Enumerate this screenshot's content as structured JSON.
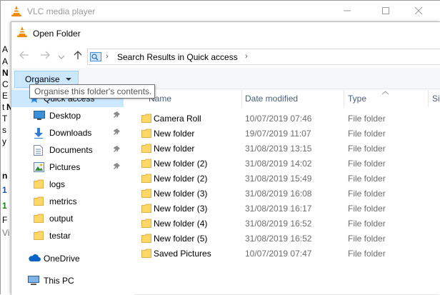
{
  "app": {
    "title": "VLC media player",
    "side_letters": [
      "A",
      "A",
      "N",
      "C",
      "E",
      "t",
      "N",
      "T",
      "s",
      "y",
      "n",
      "1",
      "1",
      "F",
      "Vi"
    ]
  },
  "dialog": {
    "title": "Open Folder",
    "address": {
      "location": "Search Results in Quick access"
    },
    "command_bar": {
      "organise_label": "Organise",
      "organise_tooltip": "Organise this folder's contents."
    },
    "nav_pane": {
      "items": [
        {
          "label": "Quick access",
          "icon": "star-icon",
          "selected": true,
          "pinned": false
        },
        {
          "label": "Desktop",
          "icon": "desktop-icon",
          "selected": false,
          "pinned": true
        },
        {
          "label": "Downloads",
          "icon": "download-arrow-icon",
          "selected": false,
          "pinned": true
        },
        {
          "label": "Documents",
          "icon": "documents-icon",
          "selected": false,
          "pinned": true
        },
        {
          "label": "Pictures",
          "icon": "pictures-icon",
          "selected": false,
          "pinned": true
        },
        {
          "label": "logs",
          "icon": "folder-icon",
          "selected": false,
          "pinned": false
        },
        {
          "label": "metrics",
          "icon": "folder-icon",
          "selected": false,
          "pinned": false
        },
        {
          "label": "output",
          "icon": "folder-icon",
          "selected": false,
          "pinned": false
        },
        {
          "label": "testar",
          "icon": "folder-icon",
          "selected": false,
          "pinned": false
        },
        {
          "label": "OneDrive",
          "icon": "cloud-icon",
          "selected": false,
          "pinned": false
        },
        {
          "label": "This PC",
          "icon": "computer-icon",
          "selected": false,
          "pinned": false
        }
      ]
    },
    "columns": {
      "name": "Name",
      "date_modified": "Date modified",
      "type": "Type",
      "size": "Si"
    },
    "files": [
      {
        "name": "Camera Roll",
        "date": "10/07/2019 07:46",
        "type": "File folder"
      },
      {
        "name": "New folder",
        "date": "19/07/2019 11:07",
        "type": "File folder"
      },
      {
        "name": "New folder",
        "date": "31/08/2019 13:15",
        "type": "File folder"
      },
      {
        "name": "New folder (2)",
        "date": "31/08/2019 14:02",
        "type": "File folder"
      },
      {
        "name": "New folder (2)",
        "date": "31/08/2019 15:49",
        "type": "File folder"
      },
      {
        "name": "New folder (3)",
        "date": "31/08/2019 16:08",
        "type": "File folder"
      },
      {
        "name": "New folder (3)",
        "date": "31/08/2019 16:17",
        "type": "File folder"
      },
      {
        "name": "New folder (4)",
        "date": "31/08/2019 16:52",
        "type": "File folder"
      },
      {
        "name": "New folder (5)",
        "date": "31/08/2019 16:52",
        "type": "File folder"
      },
      {
        "name": "Saved Pictures",
        "date": "10/07/2019 07:47",
        "type": "File folder"
      }
    ]
  },
  "colors": {
    "selection": "#cce8ff",
    "folder_yellow": "#ffd766",
    "accent_blue": "#1e88e5"
  }
}
